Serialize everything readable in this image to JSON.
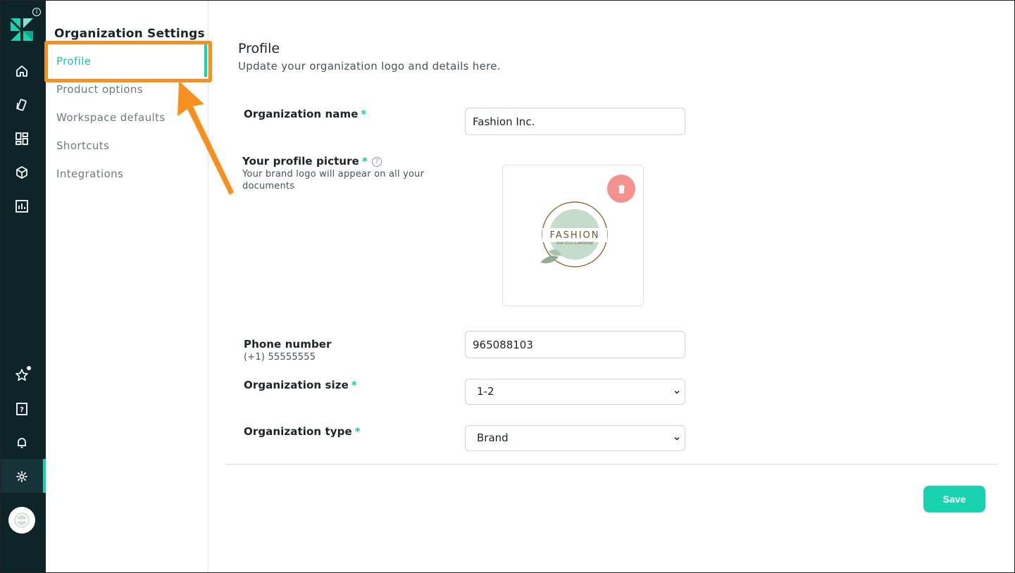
{
  "rail": {
    "icons": [
      "home-icon",
      "tag-icon",
      "dashboard-icon",
      "cube-icon",
      "bar-chart-icon",
      "star-icon",
      "help-book-icon",
      "bell-icon",
      "gear-icon"
    ],
    "accent": "#19d3b0",
    "background": "#0f2429"
  },
  "settings_nav": {
    "title": "Organization Settings",
    "items": [
      {
        "label": "Profile",
        "active": true
      },
      {
        "label": "Product options",
        "active": false
      },
      {
        "label": "Workspace defaults",
        "active": false
      },
      {
        "label": "Shortcuts",
        "active": false
      },
      {
        "label": "Integrations",
        "active": false
      }
    ]
  },
  "profile": {
    "title": "Profile",
    "subtitle": "Update your organization logo and details here.",
    "org_name_label": "Organization name",
    "org_name_value": "Fashion Inc.",
    "picture_label": "Your profile picture",
    "picture_hint": "Your brand logo will appear on all your documents",
    "logo_text": "FASHION",
    "logo_tagline": "YOUR STYLE IS IMPORTANT",
    "phone_label": "Phone number",
    "phone_hint": "(+1) 55555555",
    "phone_value": "965088103",
    "size_label": "Organization size",
    "size_value": "1-2",
    "type_label": "Organization type",
    "type_value": "Brand",
    "required_mark": "*",
    "save_label": "Save"
  }
}
